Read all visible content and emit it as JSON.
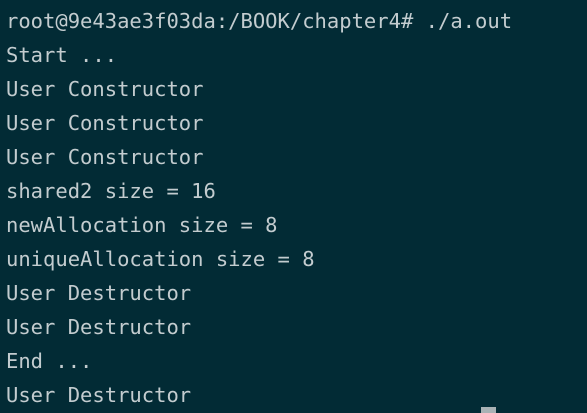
{
  "terminal": {
    "prompt": "root@9e43ae3f03da:/BOOK/chapter4# ",
    "command": "./a.out",
    "output": [
      "Start ...",
      "User Constructor",
      "User Constructor",
      "User Constructor",
      "shared2 size = 16",
      "newAllocation size = 8",
      "uniqueAllocation size = 8",
      "User Destructor",
      "User Destructor",
      "End ...",
      "User Destructor"
    ]
  }
}
